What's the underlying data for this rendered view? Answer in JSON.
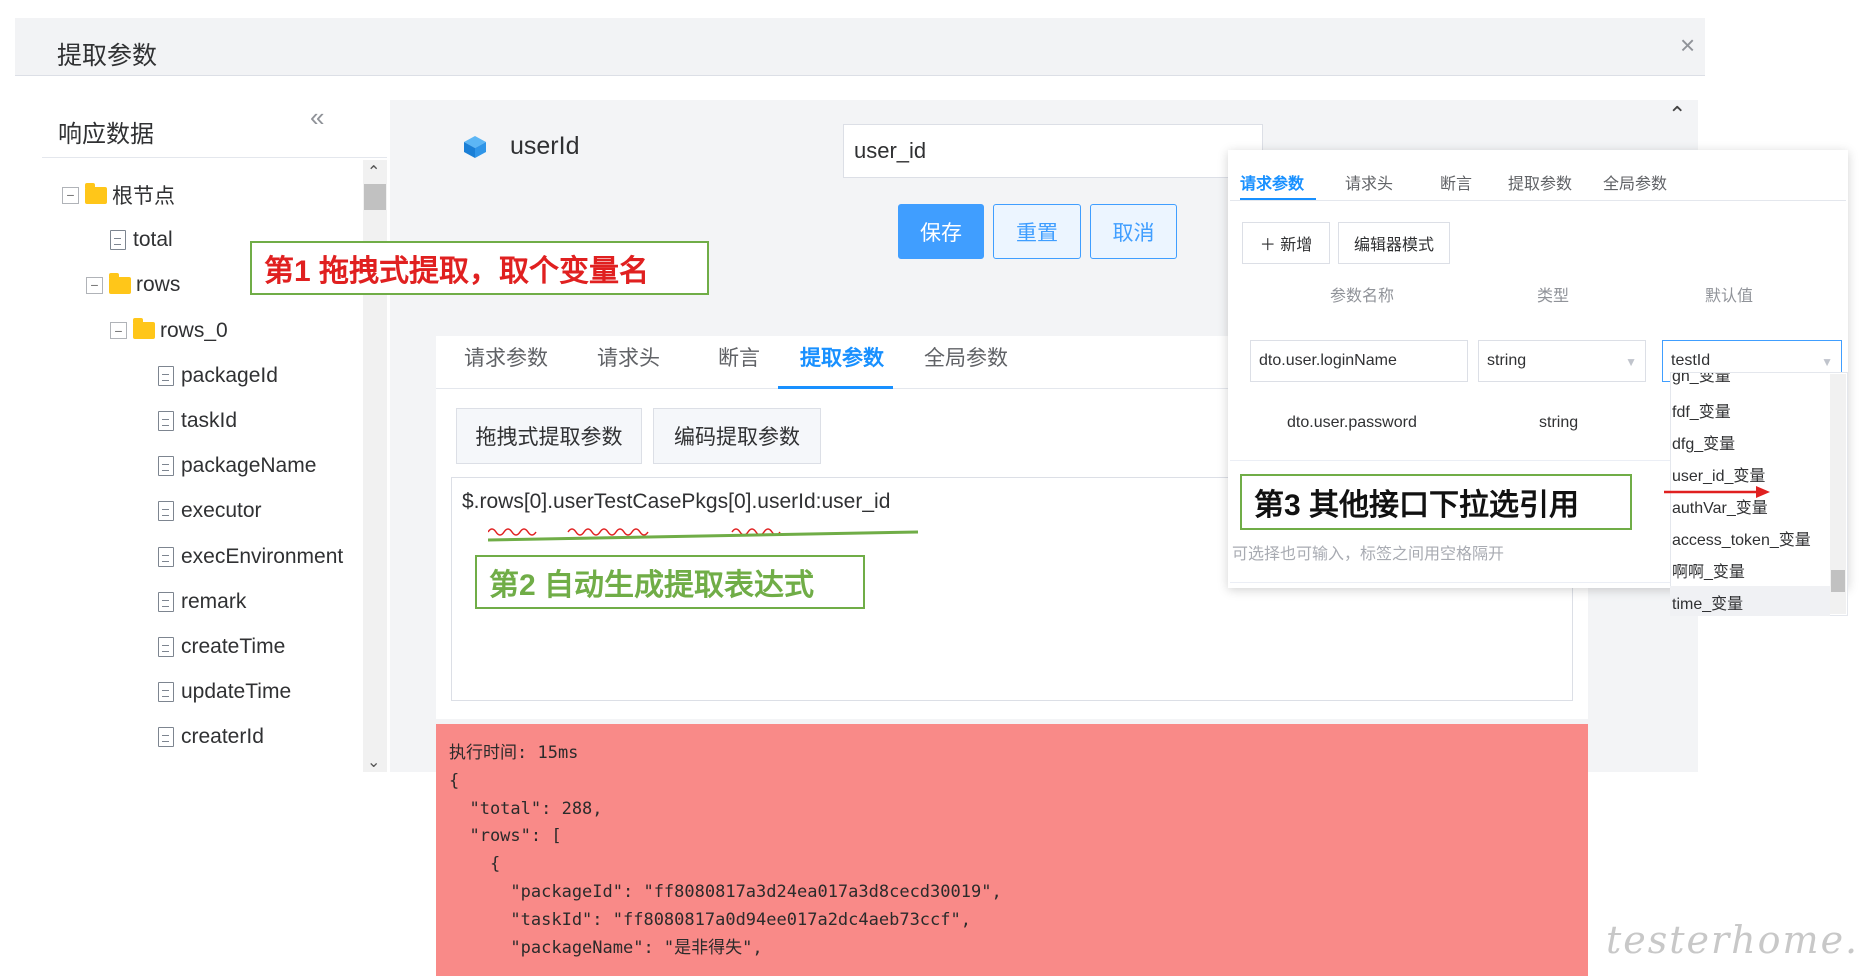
{
  "dialog": {
    "title": "提取参数",
    "close_symbol": "×"
  },
  "response": {
    "title": "响应数据",
    "collapse_symbol": "«",
    "scroll_up": "⌃",
    "scroll_down": "⌄",
    "tree": [
      {
        "label": "根节点",
        "icon": "folder-icon",
        "toggle": "−"
      },
      {
        "label": "total",
        "icon": "file-icon"
      },
      {
        "label": "rows",
        "icon": "folder-icon",
        "toggle": "−"
      },
      {
        "label": "rows_0",
        "icon": "folder-icon",
        "toggle": "−"
      },
      {
        "label": "packageId",
        "icon": "file-icon"
      },
      {
        "label": "taskId",
        "icon": "file-icon"
      },
      {
        "label": "packageName",
        "icon": "file-icon"
      },
      {
        "label": "executor",
        "icon": "file-icon"
      },
      {
        "label": "execEnvironment",
        "icon": "file-icon"
      },
      {
        "label": "remark",
        "icon": "file-icon"
      },
      {
        "label": "createTime",
        "icon": "file-icon"
      },
      {
        "label": "updateTime",
        "icon": "file-icon"
      },
      {
        "label": "createrId",
        "icon": "file-icon"
      }
    ]
  },
  "extract": {
    "node_label": "userId",
    "variable_name": "user_id",
    "buttons": {
      "save": "保存",
      "reset": "重置",
      "cancel": "取消"
    },
    "tabs": [
      "请求参数",
      "请求头",
      "断言",
      "提取参数",
      "全局参数"
    ],
    "active_tab": "提取参数",
    "mode_buttons": {
      "drag": "拖拽式提取参数",
      "code": "编码提取参数"
    },
    "expression": "$.rows[0].userTestCasePkgs[0].userId:user_id",
    "scroll_up": "⌃"
  },
  "request_popover": {
    "tabs": [
      "请求参数",
      "请求头",
      "断言",
      "提取参数",
      "全局参数"
    ],
    "active_tab": "请求参数",
    "add_button": "＋ 新增",
    "editor_button": "编辑器模式",
    "columns": {
      "name": "参数名称",
      "type": "类型",
      "default": "默认值"
    },
    "rows": [
      {
        "name": "dto.user.loginName",
        "type": "string",
        "default": "testId"
      },
      {
        "name": "dto.user.password",
        "type": "string"
      }
    ],
    "hint": "可选择也可输入，标签之间用空格隔开",
    "dropdown_options": [
      "gh_变量",
      "fdf_变量",
      "dfg_变量",
      "user_id_变量",
      "authVar_变量",
      "access_token_变量",
      "啊啊_变量",
      "time_变量"
    ]
  },
  "annotations": {
    "step1": "第1 拖拽式提取，取个变量名",
    "step2": "第2  自动生成提取表达式",
    "step3": "第3  其他接口下拉选引用"
  },
  "result": {
    "text": "执行时间: 15ms\n{\n  \"total\": 288,\n  \"rows\": [\n    {\n      \"packageId\": \"ff8080817a3d24ea017a3d8cecd30019\",\n      \"taskId\": \"ff8080817a0d94ee017a2dc4aeb73ccf\",\n      \"packageName\": \"是非得失\","
  },
  "watermark": "testerhome.com",
  "colors": {
    "primary": "#409eff",
    "tab_active": "#1890ff",
    "result_bg": "#f98a88",
    "annotation_border": "#70ad47",
    "annotation_red": "#e02020",
    "folder": "#ffc619"
  }
}
